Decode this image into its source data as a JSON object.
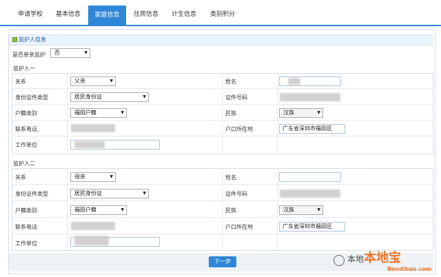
{
  "tabs": [
    {
      "label": "申请学校",
      "active": false
    },
    {
      "label": "基本信息",
      "active": false
    },
    {
      "label": "家庭信息",
      "active": true
    },
    {
      "label": "住房信息",
      "active": false
    },
    {
      "label": "计生信息",
      "active": false
    },
    {
      "label": "类别积分",
      "active": false
    }
  ],
  "section_title": "监护人信息",
  "single_parent": {
    "label": "是否单亲监护",
    "value": "否"
  },
  "guardians": [
    {
      "title": "监护人一",
      "relation_label": "关系",
      "relation_value": "父亲",
      "name_label": "姓名",
      "idtype_label": "身份证件类型",
      "idtype_value": "居民身份证",
      "idno_label": "证件号码",
      "hukou_label": "户籍类别",
      "hukou_value": "福田户籍",
      "ethnic_label": "民族",
      "ethnic_value": "汉族",
      "phone_label": "联系电话",
      "address_label": "户口所在地",
      "address_value": "广东省深圳市福田区",
      "work_label": "工作单位"
    },
    {
      "title": "监护人二",
      "relation_label": "关系",
      "relation_value": "母亲",
      "name_label": "姓名",
      "idtype_label": "身份证件类型",
      "idtype_value": "居民身份证",
      "idno_label": "证件号码",
      "hukou_label": "户籍类别",
      "hukou_value": "福田户籍",
      "ethnic_label": "民族",
      "ethnic_value": "汉族",
      "phone_label": "联系电话",
      "address_label": "户口所在地",
      "address_value": "广东省深圳市福田区",
      "work_label": "工作单位"
    }
  ],
  "next_button": "下一步",
  "watermark": {
    "text": "本地宝",
    "url": "Bendibao.com",
    "prefix": "本地"
  }
}
